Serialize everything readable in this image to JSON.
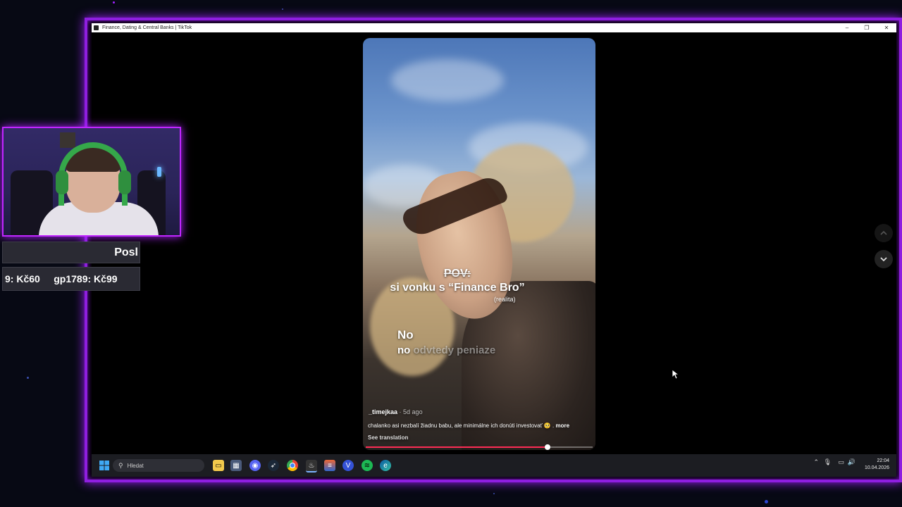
{
  "window": {
    "title": "Finance, Dating & Central Banks | TikTok",
    "controls": [
      "–",
      "❐",
      "✕"
    ]
  },
  "video": {
    "overlay_pov": "POV:",
    "overlay_caption": "si vonku s “Finance Bro”",
    "overlay_realita": "(realita)",
    "subtitle_line1": "No",
    "subtitle_line2_word": "no",
    "subtitle_line2_rest": "odvtedy peniaze",
    "username": "_timejkaa",
    "time_ago": "· 5d ago",
    "description": "chalanko asi nezbalí žiadnu babu, ale minimálne ich donúti investovať 🥺 .",
    "more_label": "more",
    "see_translation": "See translation",
    "progress": 0.8
  },
  "nav": {
    "up_icon": "chevron-up-icon",
    "down_icon": "chevron-down-icon"
  },
  "taskbar": {
    "search_placeholder": "Hledat",
    "time": "22:04",
    "date": "10.04.2026",
    "pinned_icons": [
      "file-explorer-icon",
      "calculator-icon",
      "discord-icon",
      "steam-icon",
      "chrome-icon",
      "obs-icon",
      "app-icon",
      "vpn-icon",
      "spotify-icon",
      "edge-icon"
    ]
  },
  "overlay": {
    "ticker_top": "Posl",
    "ticker_bottom": "9: Kč60     gp1789: Kč99"
  }
}
